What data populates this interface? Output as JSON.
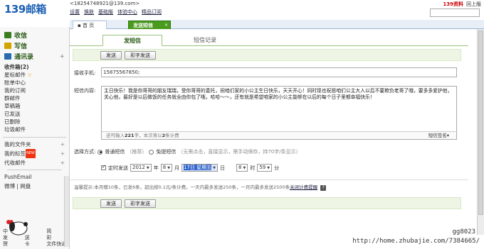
{
  "header": {
    "logo_num": "139",
    "logo_text": "邮箱",
    "account": "<18254748921@139.com>",
    "links": [
      "设置",
      "换肤",
      "基础版",
      "体验中心",
      "精品订阅"
    ],
    "right_links": [
      "139资料",
      "回上版"
    ]
  },
  "tabs": [
    {
      "label": "首 页"
    },
    {
      "label": "发送短信"
    }
  ],
  "sidebar": {
    "main": [
      {
        "label": "收信",
        "color": "#3a7d1f"
      },
      {
        "label": "写信",
        "color": "#d2a400"
      },
      {
        "label": "通讯录",
        "color": "#2a6ab0"
      }
    ],
    "folders": [
      "收件箱(2)",
      "星标邮件",
      "账单中心",
      "我的订阅",
      "群邮件",
      "草稿箱",
      "已发送",
      "已删除",
      "垃圾邮件"
    ],
    "sub": [
      "我的文件夹",
      "我的标签",
      "代收邮件"
    ],
    "new_badge": "NEW",
    "push": "PushEmail",
    "bottom": [
      "微博",
      "网盘"
    ],
    "bottom_grid": [
      "中",
      "·",
      "简",
      "发",
      "送",
      "彩",
      "贺",
      "卡",
      "文件快递"
    ]
  },
  "sms": {
    "subtab_active": "发短信",
    "subtab_inactive": "短信记录",
    "send_label": "发送",
    "color_send_label": "彩字发送",
    "phone_label": "接收手机:",
    "phone_value": "15875567850;",
    "content_label": "短信内容:",
    "content_text": "主日快乐！我是你哥哥的朋友瑞瑞，受你哥哥的委托，祝咱们家的小公主生日快乐，天天开心！同时现也祝愿咱们公主大人以后不要欺负老哥了哦，要多多爱护他，关心他，最好是以后做饭的任务就全由你包了哦，哈哈～～，还有就是希望咱家的小公主能够在以后的每个日子里都幸福快乐！",
    "count_prefix": "还可输入",
    "count_value": "221",
    "count_suffix": "字，本次将以",
    "count_parts": "2",
    "count_end": "条计费",
    "signature": "短信签名",
    "mode_label": "选择方式:",
    "mode_normal": "普通短信",
    "mode_normal_note": "（推荐）",
    "mode_free": "免提短信",
    "mode_free_note": "（无需点击，直接显示，需手动保存，持70字/条显示）",
    "timing_label": "定时发送",
    "year": "2012",
    "year_unit": "年",
    "month": "8",
    "month_unit": "月",
    "day": "17日 星期五",
    "day_unit": "日",
    "hour": "8",
    "hour_unit": "时",
    "minute": "59",
    "minute_unit": "分",
    "tip": "温馨提示:本月赠10条，已发6条，超出按0.1元/条计费。一天内最多发送250条，一月内最多发送2500条",
    "tip_link": "关闭计费提醒",
    "help": "?"
  },
  "watermark": {
    "user": "gg8023",
    "url": "http://home.zhubajie.com/7384665/"
  }
}
